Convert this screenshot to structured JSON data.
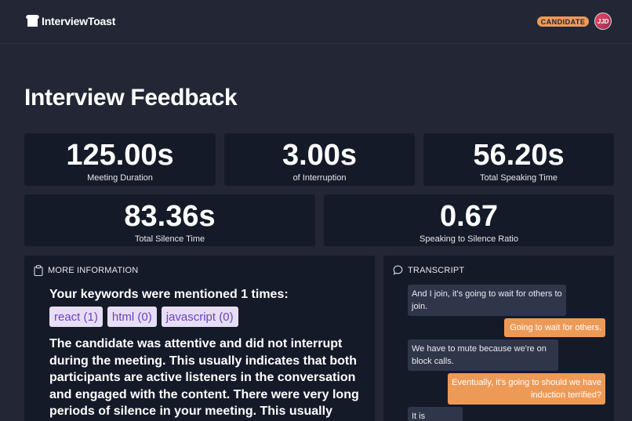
{
  "header": {
    "logo_text": "InterviewToast",
    "role_badge": "CANDIDATE",
    "avatar_text": "JJD"
  },
  "page": {
    "title": "Interview Feedback"
  },
  "stats": [
    {
      "value": "125.00s",
      "label": "Meeting Duration"
    },
    {
      "value": "3.00s",
      "label": "of Interruption"
    },
    {
      "value": "56.20s",
      "label": "Total Speaking Time"
    },
    {
      "value": "83.36s",
      "label": "Total Silence Time"
    },
    {
      "value": "0.67",
      "label": "Speaking to Silence Ratio"
    }
  ],
  "more_info": {
    "title": "MORE INFORMATION",
    "keywords_heading": "Your keywords were mentioned 1 times:",
    "keywords": [
      "react (1)",
      "html (0)",
      "javascript (0)"
    ],
    "feedback": "The candidate was attentive and did not interrupt during the meeting. This usually indicates that both participants are active listeners in the conversation and engaged with the content. There were very long periods of silence in your meeting. This usually"
  },
  "transcript": {
    "title": "TRANSCRIPT",
    "messages": [
      {
        "side": "left",
        "text": "And I join, it's going to wait for others to join."
      },
      {
        "side": "right",
        "text": "Going to wait for others."
      },
      {
        "side": "left",
        "text": "We have to mute because we're on block calls."
      },
      {
        "side": "right",
        "text": "Eventually, it's going to should we have induction terrified?"
      },
      {
        "side": "left",
        "text": "It is working."
      }
    ]
  },
  "colors": {
    "background": "#232735",
    "card": "#151a29",
    "accent_orange": "#ee9a57",
    "chip_bg": "#e7def5",
    "chip_text": "#6b41c4"
  },
  "icons": {
    "logo": "toast-icon",
    "more_info": "clipboard-icon",
    "transcript": "chat-bubble-icon"
  }
}
